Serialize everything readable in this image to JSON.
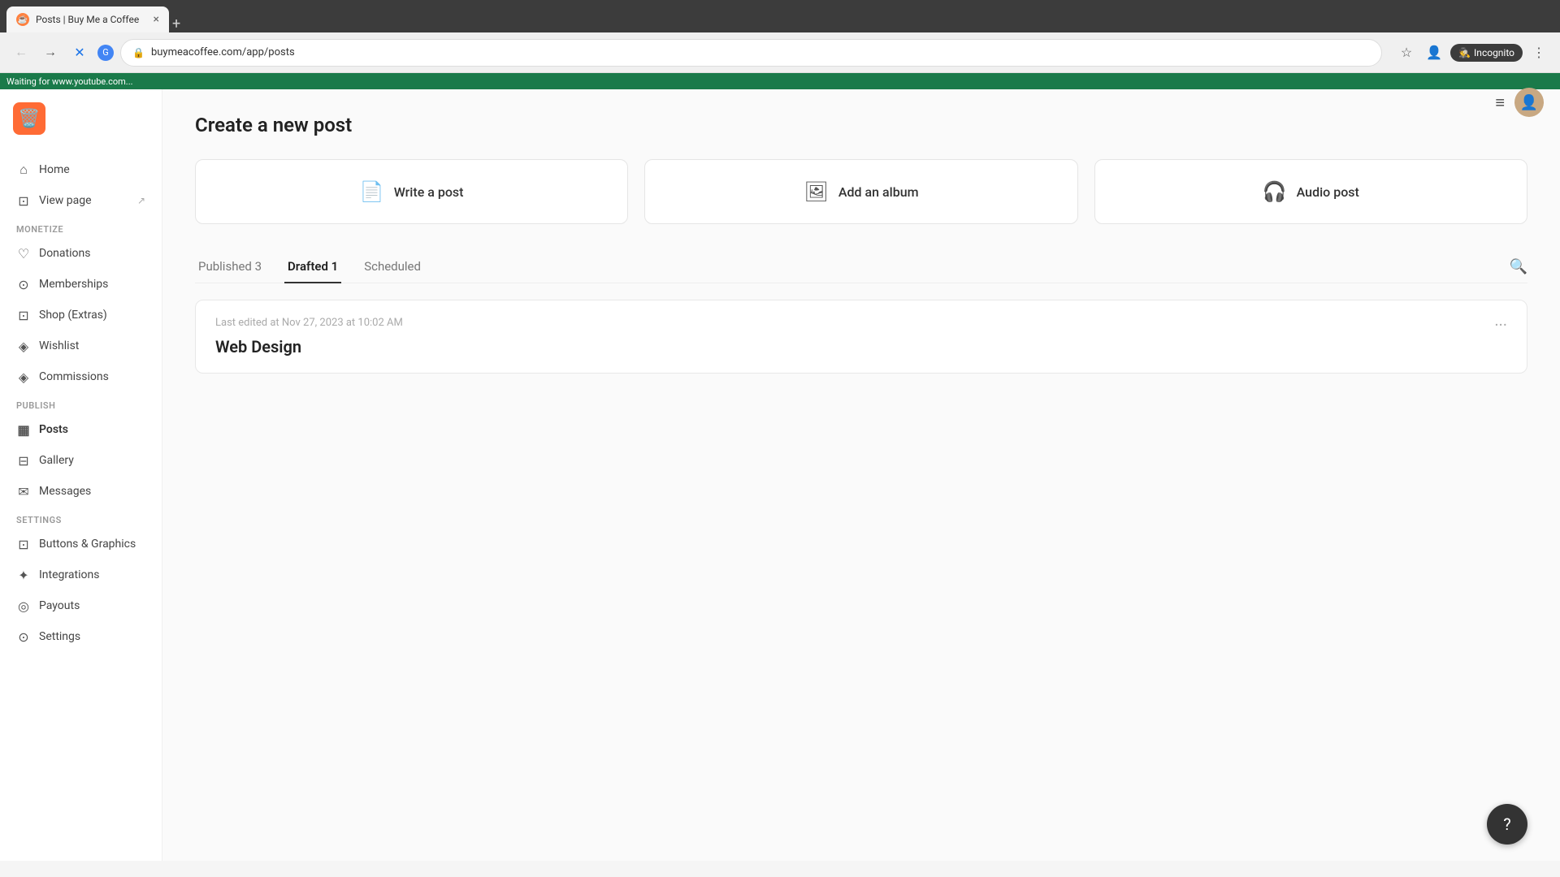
{
  "browser": {
    "tab_title": "Posts | Buy Me a Coffee",
    "tab_favicon": "☕",
    "url": "buymeacoffee.com/app/posts",
    "new_tab_icon": "+",
    "close_tab_icon": "×",
    "nav_back": "←",
    "nav_forward": "→",
    "nav_reload": "✕",
    "incognito_label": "Incognito",
    "address_bar_lock": "🔒"
  },
  "status_bar": {
    "text": "Waiting for www.youtube.com..."
  },
  "sidebar": {
    "logo_emoji": "🗑️",
    "nav_main": [
      {
        "id": "home",
        "label": "Home",
        "icon": "⌂"
      },
      {
        "id": "view-page",
        "label": "View page",
        "icon": "⊡",
        "external": true
      }
    ],
    "section_monetize": "MONETIZE",
    "nav_monetize": [
      {
        "id": "donations",
        "label": "Donations",
        "icon": "♡"
      },
      {
        "id": "memberships",
        "label": "Memberships",
        "icon": "⊙"
      },
      {
        "id": "shop",
        "label": "Shop (Extras)",
        "icon": "⊡"
      },
      {
        "id": "wishlist",
        "label": "Wishlist",
        "icon": "◈"
      },
      {
        "id": "commissions",
        "label": "Commissions",
        "icon": "◈"
      }
    ],
    "section_publish": "PUBLISH",
    "nav_publish": [
      {
        "id": "posts",
        "label": "Posts",
        "icon": "▦",
        "active": true
      },
      {
        "id": "gallery",
        "label": "Gallery",
        "icon": "⊟"
      },
      {
        "id": "messages",
        "label": "Messages",
        "icon": "✉"
      }
    ],
    "section_settings": "SETTINGS",
    "nav_settings": [
      {
        "id": "buttons-graphics",
        "label": "Buttons & Graphics",
        "icon": "⊡"
      },
      {
        "id": "integrations",
        "label": "Integrations",
        "icon": "✦"
      },
      {
        "id": "payouts",
        "label": "Payouts",
        "icon": "◎"
      },
      {
        "id": "settings",
        "label": "Settings",
        "icon": "⊙"
      }
    ]
  },
  "header": {
    "hamburger": "≡"
  },
  "main": {
    "page_title": "Create a new post",
    "create_options": [
      {
        "id": "write-post",
        "icon": "📄",
        "label": "Write a post"
      },
      {
        "id": "add-album",
        "icon": "🖼",
        "label": "Add an album"
      },
      {
        "id": "audio-post",
        "icon": "🎧",
        "label": "Audio post"
      }
    ],
    "tabs": [
      {
        "id": "published",
        "label": "Published 3",
        "active": false
      },
      {
        "id": "drafted",
        "label": "Drafted 1",
        "active": true
      },
      {
        "id": "scheduled",
        "label": "Scheduled",
        "active": false
      }
    ],
    "posts": [
      {
        "id": "web-design",
        "meta": "Last edited at Nov 27, 2023 at 10:02 AM",
        "title": "Web Design"
      }
    ]
  },
  "help": {
    "icon": "?"
  }
}
